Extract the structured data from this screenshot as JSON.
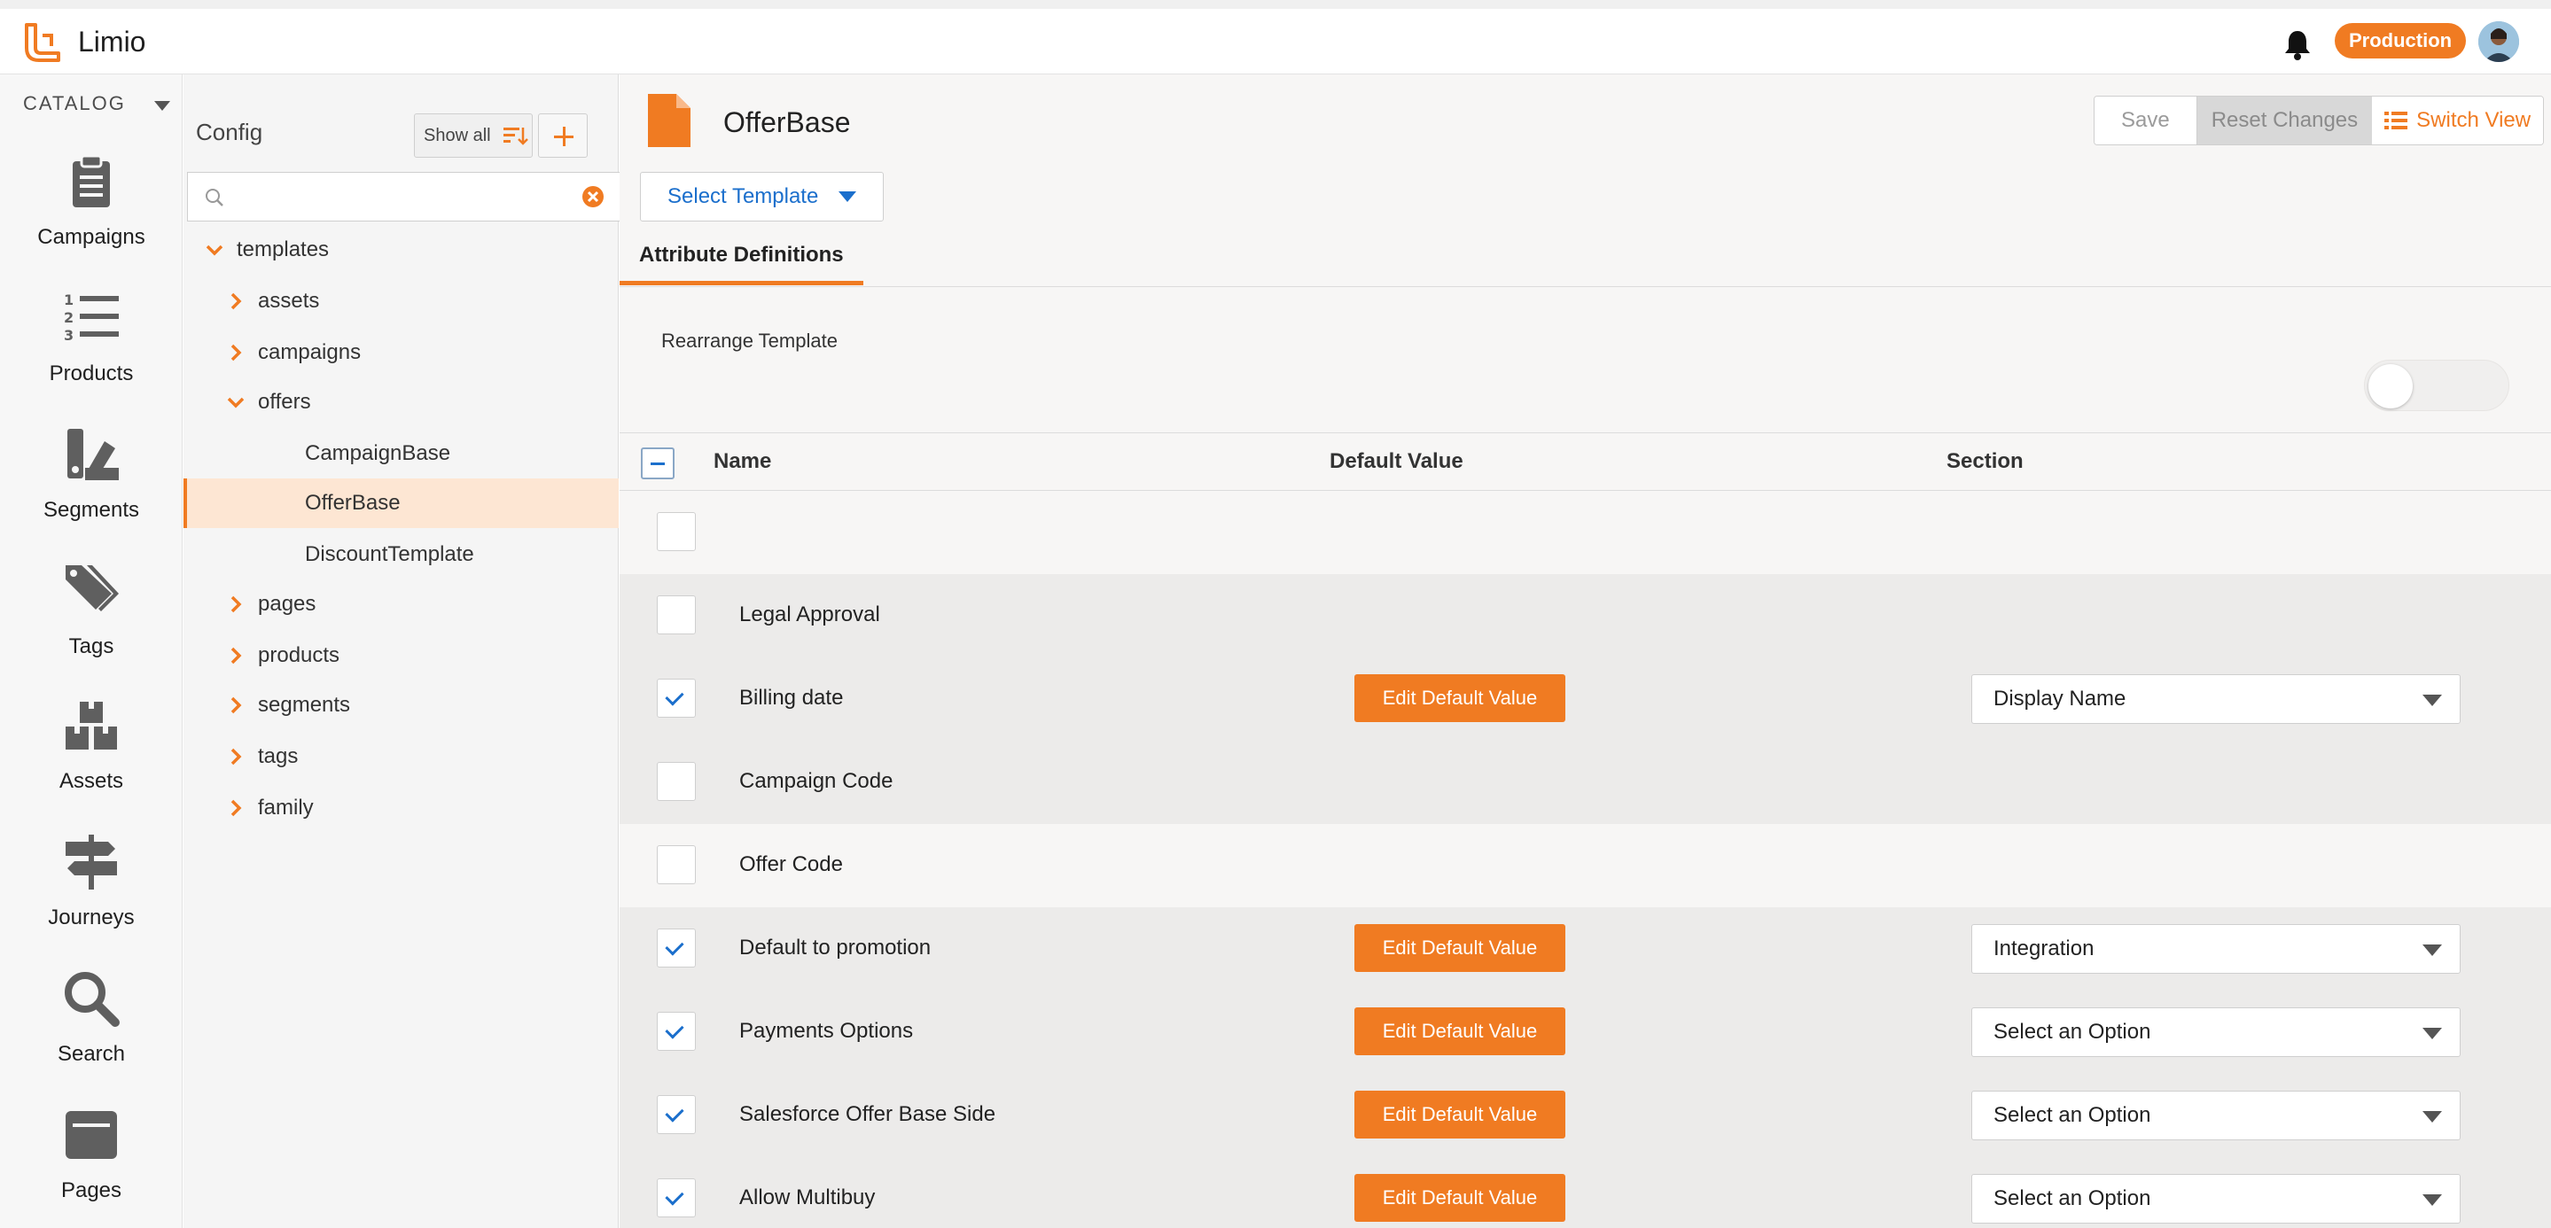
{
  "app": {
    "name": "Limio",
    "environment": "Production"
  },
  "leftnav": {
    "catalog_label": "CATALOG",
    "items": [
      {
        "label": "Campaigns",
        "icon": "clipboard-icon"
      },
      {
        "label": "Products",
        "icon": "numbered-list-icon"
      },
      {
        "label": "Segments",
        "icon": "swatches-icon"
      },
      {
        "label": "Tags",
        "icon": "tag-icon"
      },
      {
        "label": "Assets",
        "icon": "boxes-icon"
      },
      {
        "label": "Journeys",
        "icon": "signpost-icon"
      },
      {
        "label": "Search",
        "icon": "search-icon"
      },
      {
        "label": "Pages",
        "icon": "page-window-icon"
      }
    ]
  },
  "tree": {
    "title": "Config",
    "show_all_label": "Show all",
    "search_placeholder": "",
    "nodes": [
      {
        "label": "templates",
        "expanded": true
      },
      {
        "label": "assets"
      },
      {
        "label": "campaigns"
      },
      {
        "label": "offers",
        "expanded": true
      },
      {
        "label": "CampaignBase"
      },
      {
        "label": "OfferBase",
        "selected": true
      },
      {
        "label": "DiscountTemplate"
      },
      {
        "label": "pages"
      },
      {
        "label": "products"
      },
      {
        "label": "segments"
      },
      {
        "label": "tags"
      },
      {
        "label": "family"
      }
    ]
  },
  "main": {
    "title": "OfferBase",
    "actions": {
      "save": "Save",
      "reset": "Reset Changes",
      "switch": "Switch View"
    },
    "select_template": "Select Template",
    "tab": "Attribute Definitions",
    "rearrange_label": "Rearrange Template",
    "rearrange_on": false,
    "columns": {
      "name": "Name",
      "default_value": "Default Value",
      "section": "Section"
    },
    "edit_label": "Edit Default Value",
    "rows": [
      {
        "name": "",
        "checked": false
      },
      {
        "name": "Legal Approval",
        "checked": false
      },
      {
        "name": "Billing date",
        "checked": true,
        "section": "Display Name"
      },
      {
        "name": "Campaign Code",
        "checked": false
      },
      {
        "name": "Offer Code",
        "checked": false
      },
      {
        "name": "Default to promotion",
        "checked": true,
        "section": "Integration"
      },
      {
        "name": "Payments Options",
        "checked": true,
        "section": "Select an Option"
      },
      {
        "name": "Salesforce Offer Base Side",
        "checked": true,
        "section": "Select an Option"
      },
      {
        "name": "Allow Multibuy",
        "checked": true,
        "section": "Select an Option"
      }
    ]
  },
  "colors": {
    "accent": "#f07b22",
    "link": "#1b6fcc"
  }
}
